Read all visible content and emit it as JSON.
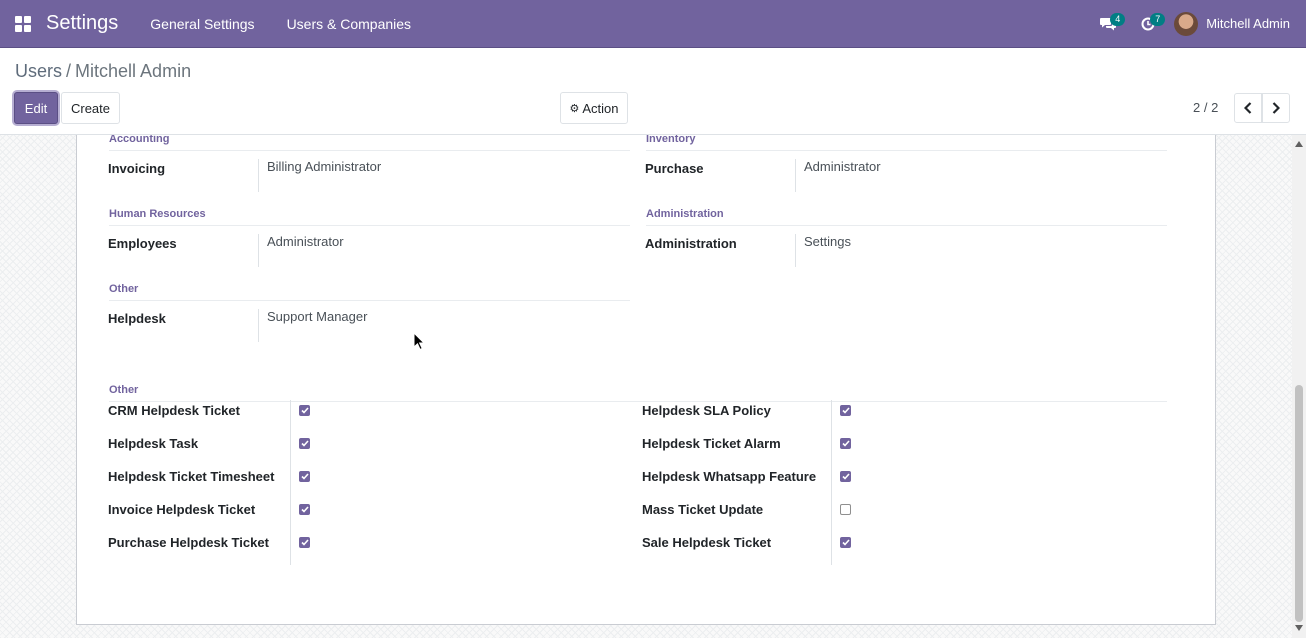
{
  "navbar": {
    "app_title": "Settings",
    "menu": [
      "General Settings",
      "Users & Companies"
    ],
    "messages_count": "4",
    "activities_count": "7",
    "user_name": "Mitchell Admin",
    "accent": "#71639e"
  },
  "breadcrumb": {
    "parent": "Users",
    "separator": "/",
    "current": "Mitchell Admin"
  },
  "buttons": {
    "edit": "Edit",
    "create": "Create",
    "action": "Action"
  },
  "pager": {
    "value": "2 / 2"
  },
  "access_rights": [
    {
      "section": "Accounting",
      "label": "Invoicing",
      "value": "Billing Administrator"
    },
    {
      "section": "Inventory",
      "label": "Purchase",
      "value": "Administrator"
    },
    {
      "section": "Human Resources",
      "label": "Employees",
      "value": "Administrator"
    },
    {
      "section": "Administration",
      "label": "Administration",
      "value": "Settings"
    },
    {
      "section": "Other",
      "label": "Helpdesk",
      "value": "Support Manager"
    }
  ],
  "other_section": {
    "title": "Other",
    "left": [
      {
        "label": "CRM Helpdesk Ticket",
        "checked": true
      },
      {
        "label": "Helpdesk Task",
        "checked": true
      },
      {
        "label": "Helpdesk Ticket Timesheet",
        "checked": true
      },
      {
        "label": "Invoice Helpdesk Ticket",
        "checked": true
      },
      {
        "label": "Purchase Helpdesk Ticket",
        "checked": true
      }
    ],
    "right": [
      {
        "label": "Helpdesk SLA Policy",
        "checked": true
      },
      {
        "label": "Helpdesk Ticket Alarm",
        "checked": true
      },
      {
        "label": "Helpdesk Whatsapp Feature",
        "checked": true
      },
      {
        "label": "Mass Ticket Update",
        "checked": false
      },
      {
        "label": "Sale Helpdesk Ticket",
        "checked": true
      }
    ]
  }
}
